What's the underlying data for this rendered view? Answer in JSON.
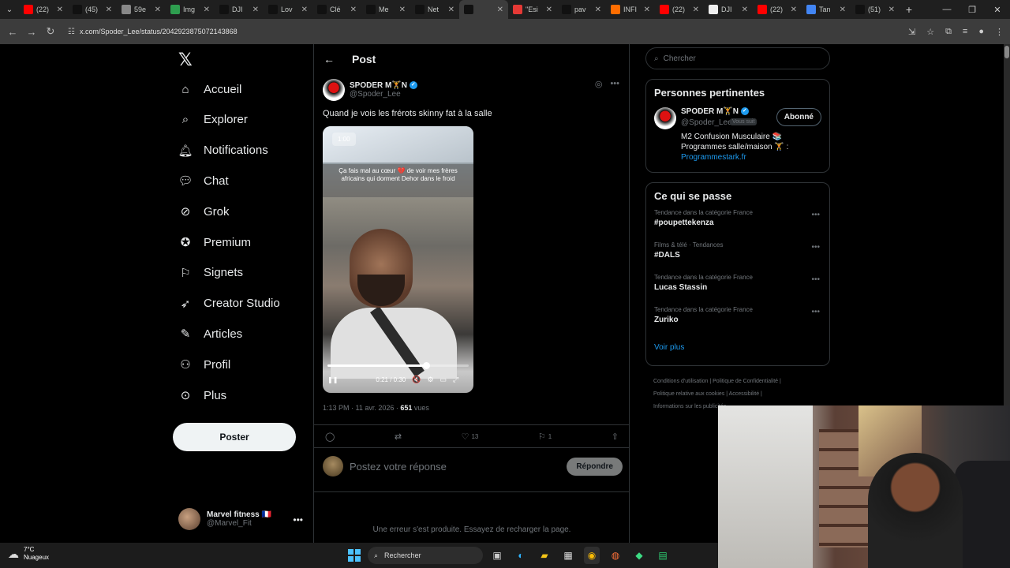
{
  "browser": {
    "tabs": [
      {
        "label": "(22)",
        "color": "#ff0000",
        "icon": "youtube-icon"
      },
      {
        "label": "(45)",
        "color": "#111111",
        "icon": "tiktok-icon"
      },
      {
        "label": "59e",
        "color": "#888888",
        "icon": "globe-icon"
      },
      {
        "label": "Img",
        "color": "#2e9e4f",
        "icon": "image-icon"
      },
      {
        "label": "DJI",
        "color": "#111111",
        "icon": "x-icon"
      },
      {
        "label": "Lov",
        "color": "#111111",
        "icon": "x-icon"
      },
      {
        "label": "Clé",
        "color": "#111111",
        "icon": "x-icon"
      },
      {
        "label": "Me",
        "color": "#111111",
        "icon": "x-icon"
      },
      {
        "label": "Net",
        "color": "#111111",
        "icon": "x-icon"
      },
      {
        "label": "",
        "color": "#111111",
        "icon": "x-icon",
        "active": true
      },
      {
        "label": "\"Esi",
        "color": "#e53935",
        "icon": "e-icon"
      },
      {
        "label": "pav",
        "color": "#111111",
        "icon": "x-icon"
      },
      {
        "label": "INFI",
        "color": "#ff6d00",
        "icon": "b-icon"
      },
      {
        "label": "(22)",
        "color": "#ff0000",
        "icon": "youtube-icon"
      },
      {
        "label": "DJI",
        "color": "#eeeeee",
        "icon": "doc-icon"
      },
      {
        "label": "(22)",
        "color": "#ff0000",
        "icon": "youtube-icon"
      },
      {
        "label": "Tan",
        "color": "#4285f4",
        "icon": "google-icon"
      },
      {
        "label": "(51)",
        "color": "#111111",
        "icon": "tiktok-icon"
      }
    ],
    "url": "x.com/Spoder_Lee/status/2042923875072143868"
  },
  "nav": {
    "items": [
      {
        "label": "Accueil",
        "icon": "home-icon"
      },
      {
        "label": "Explorer",
        "icon": "search-icon"
      },
      {
        "label": "Notifications",
        "icon": "bell-icon"
      },
      {
        "label": "Chat",
        "icon": "chat-icon"
      },
      {
        "label": "Grok",
        "icon": "grok-icon"
      },
      {
        "label": "Premium",
        "icon": "premium-icon"
      },
      {
        "label": "Signets",
        "icon": "bookmark-icon"
      },
      {
        "label": "Creator Studio",
        "icon": "rocket-icon"
      },
      {
        "label": "Articles",
        "icon": "article-icon"
      },
      {
        "label": "Profil",
        "icon": "person-icon"
      },
      {
        "label": "Plus",
        "icon": "more-circle-icon"
      }
    ],
    "post_button": "Poster",
    "account": {
      "name": "Marvel fitness 🇫🇷",
      "handle": "@Marvel_Fit"
    }
  },
  "main": {
    "title": "Post",
    "author": {
      "name": "SPODER M🏋️N",
      "handle": "@Spoder_Lee"
    },
    "text": "Quand je vois les frérots skinny fat à la salle",
    "video": {
      "badge": "1:00",
      "caption": "Ça fais mal au cœur 💔 de voir mes frères africains qui dorment Dehor dans le froid",
      "time": "0:21 / 0:30",
      "progress": 0.7
    },
    "meta": {
      "time": "1:13 PM · 11 avr. 2026 · ",
      "views": "651",
      "views_label": " vues"
    },
    "actions": {
      "likes": "13",
      "bookmarks": "1"
    },
    "reply_placeholder": "Postez votre réponse",
    "reply_button": "Répondre",
    "error": "Une erreur s'est produite. Essayez de recharger la page."
  },
  "right": {
    "search_placeholder": "Chercher",
    "relevant": {
      "title": "Personnes pertinentes",
      "name": "SPODER M🏋️N",
      "handle": "@Spoder_Lee",
      "follows_you": "Vous suit",
      "follow_button": "Abonné",
      "bio_line1": "M2 Confusion Musculaire 📚",
      "bio_line2": "Programmes salle/maison 🏋️ :",
      "bio_link": "Programmestark.fr"
    },
    "trends": {
      "title": "Ce qui se passe",
      "items": [
        {
          "category": "Tendance dans la catégorie France",
          "name": "#poupettekenza"
        },
        {
          "category": "Films & télé · Tendances",
          "name": "#DALS"
        },
        {
          "category": "Tendance dans la catégorie France",
          "name": "Lucas Stassin"
        },
        {
          "category": "Tendance dans la catégorie France",
          "name": "Zuriko"
        }
      ],
      "more": "Voir plus"
    },
    "footer": {
      "l1": "Conditions d'utilisation  |  Politique de Confidentialité  |",
      "l2": "Politique relative aux cookies  |  Accessibilité  |",
      "l3": "Informations sur les publicités"
    }
  },
  "taskbar": {
    "temp": "7°C",
    "weather": "Nuageux",
    "search": "Rechercher"
  },
  "colors": {
    "accent": "#1d9bf0",
    "background": "#000000"
  }
}
